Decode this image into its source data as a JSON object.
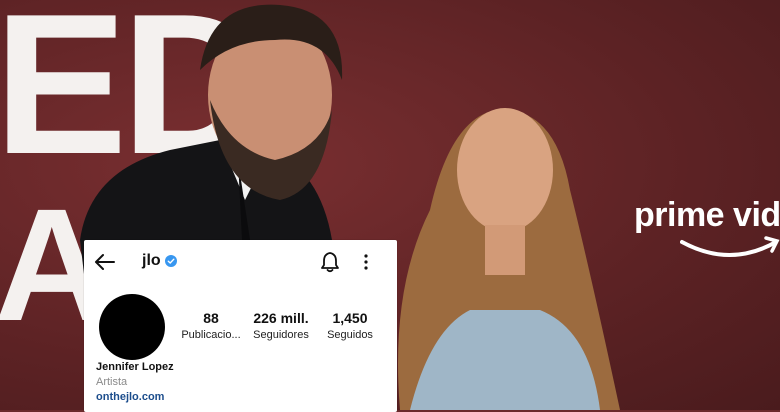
{
  "background": {
    "letters_top": "ED",
    "letters_bottom": "A",
    "brand_text": "prime vid"
  },
  "profile": {
    "handle": "jlo",
    "verified": true,
    "name": "Jennifer Lopez",
    "category": "Artista",
    "link": "onthejlo.com",
    "stats": {
      "posts": {
        "value": "88",
        "label": "Publicacio..."
      },
      "followers": {
        "value": "226 mill.",
        "label": "Seguidores"
      },
      "following": {
        "value": "1,450",
        "label": "Seguidos"
      }
    }
  },
  "icons": {
    "back": "arrow-left-icon",
    "verified": "verified-badge-icon",
    "notifications": "bell-icon",
    "more": "more-vertical-icon"
  },
  "colors": {
    "verified": "#3897f0",
    "link": "#1c4d8c",
    "backdrop": "#6b2a2c"
  }
}
